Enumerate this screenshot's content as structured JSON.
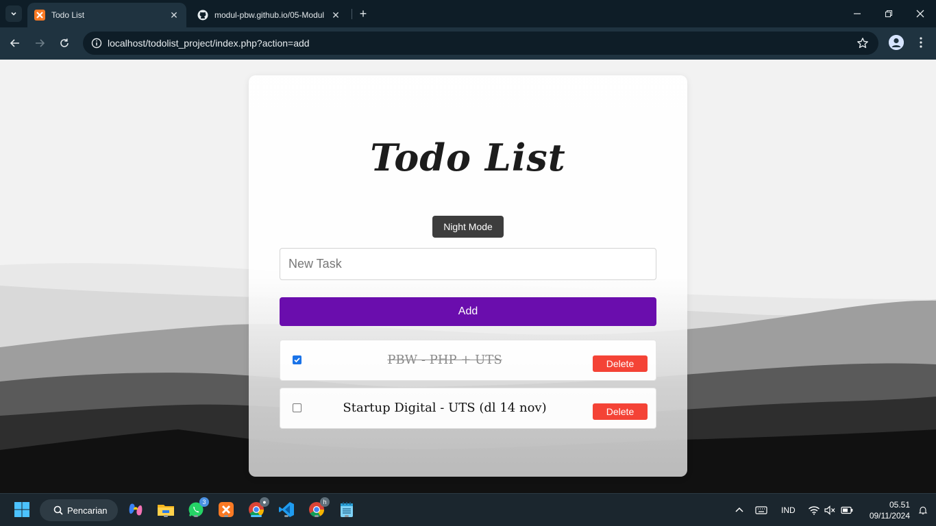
{
  "browser": {
    "tabs": [
      {
        "title": "Todo List",
        "favicon": "xampp-icon",
        "active": true
      },
      {
        "title": "modul-pbw.github.io/05-Modul",
        "favicon": "github-icon",
        "active": false
      }
    ],
    "url": "localhost/todolist_project/index.php?action=add"
  },
  "page": {
    "title": "Todo List",
    "night_mode_label": "Night Mode",
    "input_placeholder": "New Task",
    "input_value": "",
    "add_label": "Add",
    "tasks": [
      {
        "text": "PBW - PHP + UTS",
        "completed": true,
        "delete_label": "Delete"
      },
      {
        "text": "Startup Digital - UTS (dl 14 nov)",
        "completed": false,
        "delete_label": "Delete"
      }
    ]
  },
  "taskbar": {
    "search_label": "Pencarian",
    "whatsapp_badge": "3",
    "chrome_badge": "h",
    "language": "IND",
    "time": "05.51",
    "date": "09/11/2024"
  },
  "colors": {
    "add_button": "#6a0dad",
    "delete_button": "#f44336",
    "night_mode_button": "#3d3d3d"
  }
}
